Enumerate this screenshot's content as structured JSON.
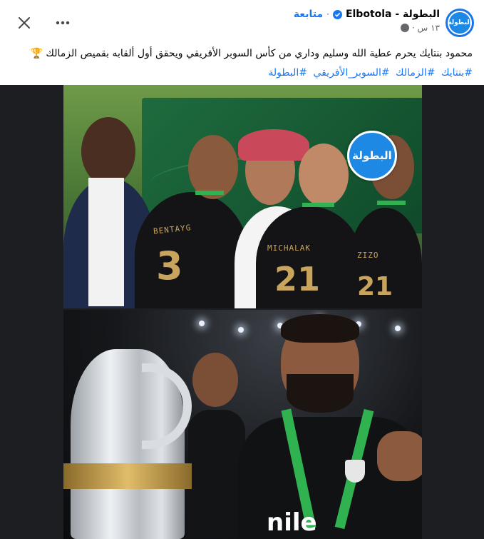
{
  "header": {
    "page_name": "البطولة - Elbotola",
    "follow_label": "متابعة",
    "separator": "·",
    "timestamp": "١٣ س ·",
    "avatar_text": "البطولة",
    "more_icon": "more-horizontal-icon",
    "close_icon": "close-icon",
    "verified_icon": "verified-badge-icon",
    "audience_icon": "globe-icon"
  },
  "post": {
    "caption": "محمود بنتايك يحرم عطية الله وسليم وداري من كأس السوبر الأفريقي ويحقق أول ألقابه بقميص الزمالك 🏆",
    "hashtags": [
      "#بنتايك",
      "#الزمالك",
      "#السوبر_الأفريقي",
      "#البطولة"
    ]
  },
  "media": {
    "watermark_text": "البطولة",
    "top_image": {
      "shirt_names": [
        "BENTAYG",
        "MICHALAK",
        "ZIZO"
      ],
      "shirt_numbers": [
        "3",
        "21",
        "21"
      ]
    },
    "bottom_image": {
      "sponsor_text": "nile"
    }
  },
  "colors": {
    "link": "#1877f2",
    "text": "#050505",
    "muted": "#65676b",
    "media_bg": "#1c1e21",
    "brand": "#1e88e5",
    "lanyard": "#2fb24f"
  }
}
